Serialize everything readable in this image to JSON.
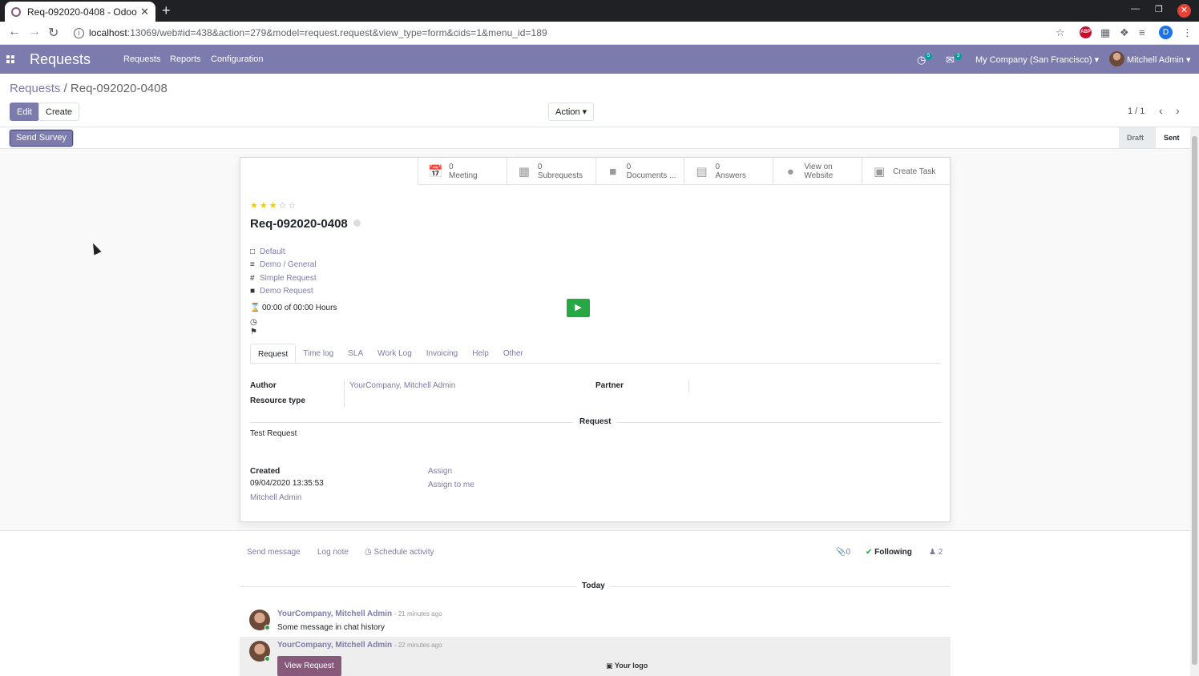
{
  "browser": {
    "tab_title": "Req-092020-0408 - Odoo",
    "tab_close": "✕",
    "new_tab": "+",
    "url_host": "localhost",
    "url_rest": ":13069/web#id=438&action=279&model=request.request&view_type=form&cids=1&menu_id=189",
    "profile_initial": "D",
    "abp_label": "ABP"
  },
  "navbar": {
    "brand": "Requests",
    "menu": [
      "Requests",
      "Reports",
      "Configuration"
    ],
    "activity_count": "5",
    "message_count": "3",
    "company": "My Company (San Francisco)",
    "user": "Mitchell Admin"
  },
  "control": {
    "breadcrumb_parent": "Requests",
    "breadcrumb_sep": "/",
    "breadcrumb_current": "Req-092020-0408",
    "edit_label": "Edit",
    "create_label": "Create",
    "action_label": "Action",
    "pager": "1 / 1"
  },
  "statusbar": {
    "send_survey": "Send Survey",
    "stages": [
      "Draft",
      "Sent"
    ]
  },
  "stat_buttons": [
    {
      "num": "0",
      "label": "Meeting",
      "icon": "calendar-icon"
    },
    {
      "num": "0",
      "label": "Subrequests",
      "icon": "sitemap-icon"
    },
    {
      "num": "0",
      "label": "Documents ...",
      "icon": "folder-icon"
    },
    {
      "num": "0",
      "label": "Answers",
      "icon": "list-icon"
    },
    {
      "num": "View on",
      "label": "Website",
      "icon": "globe-icon"
    },
    {
      "num": "",
      "label": "Create Task",
      "icon": "briefcase-icon"
    }
  ],
  "form": {
    "rating": 3,
    "rating_max": 5,
    "title": "Req-092020-0408",
    "fields": {
      "type": "Default",
      "category": "Demo / General",
      "kind": "Simple Request",
      "request_type": "Demo Request",
      "time": "00:00 of 00:00 Hours"
    },
    "tabs": [
      "Request",
      "Time log",
      "SLA",
      "Work Log",
      "Invoicing",
      "Help",
      "Other"
    ],
    "author_label": "Author",
    "author_value": "YourCompany, Mitchell Admin",
    "resource_label": "Resource type",
    "partner_label": "Partner",
    "section_title": "Request",
    "request_text": "Test Request",
    "created_label": "Created",
    "created_date": "09/04/2020 13:35:53",
    "created_by": "Mitchell Admin",
    "assign": "Assign",
    "assign_to_me": "Assign to me"
  },
  "chatter": {
    "send_message": "Send message",
    "log_note": "Log note",
    "schedule_activity": "Schedule activity",
    "attachments": "0",
    "following": "Following",
    "followers": "2",
    "today": "Today",
    "messages": [
      {
        "author": "YourCompany, Mitchell Admin",
        "time": "- 21 minutes ago",
        "body": "Some message in chat history"
      },
      {
        "author": "YourCompany, Mitchell Admin",
        "time": "- 22 minutes ago",
        "button": "View Request",
        "logo": "Your logo"
      }
    ]
  }
}
